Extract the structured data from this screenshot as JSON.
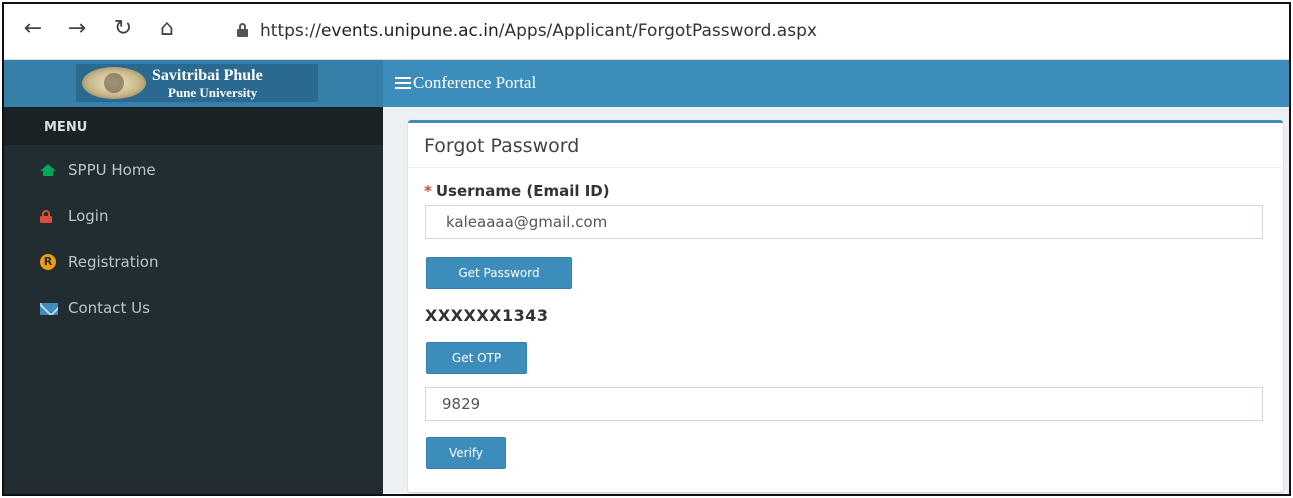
{
  "browser": {
    "back_icon": "arrow-left-icon",
    "forward_icon": "arrow-right-icon",
    "reload_icon": "reload-icon",
    "home_icon": "home-icon",
    "url_scheme": "https://",
    "url_host": "events.unipune.ac.in",
    "url_path": "/Apps/Applicant/ForgotPassword.aspx"
  },
  "header": {
    "logo_line1": "Savitribai Phule",
    "logo_line2": "Pune University",
    "portal_title": "Conference Portal",
    "accent_color": "#3c8dbc"
  },
  "sidebar": {
    "menu_label": "MENU",
    "items": [
      {
        "label": "SPPU Home",
        "icon": "home-icon",
        "icon_color": "#00a65a"
      },
      {
        "label": "Login",
        "icon": "lock-icon",
        "icon_color": "#dd4b39"
      },
      {
        "label": "Registration",
        "icon": "registered-icon",
        "icon_glyph": "R",
        "icon_color": "#f39c12"
      },
      {
        "label": "Contact Us",
        "icon": "envelope-icon",
        "icon_color": "#3c8dbc"
      }
    ]
  },
  "form": {
    "title": "Forgot Password",
    "required_marker": "*",
    "username_label": "Username (Email ID)",
    "username_value": "kaleaaaa@gmail.com",
    "get_password_label": "Get Password",
    "masked_phone": "XXXXXX1343",
    "get_otp_label": "Get OTP",
    "otp_value": "9829",
    "verify_label": "Verify"
  }
}
